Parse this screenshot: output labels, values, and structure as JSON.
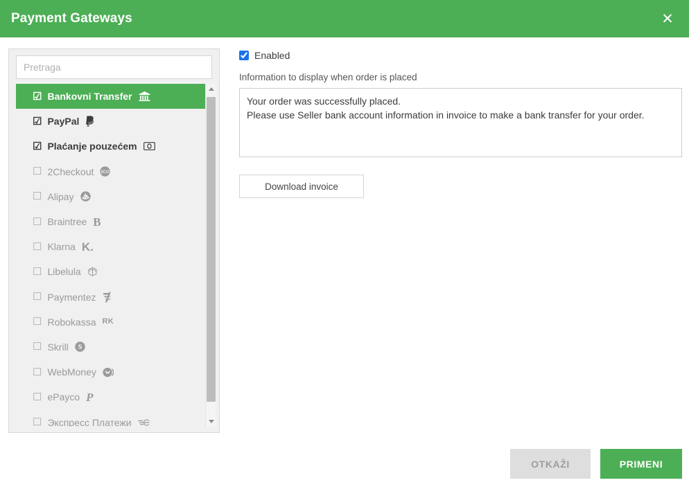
{
  "window": {
    "title": "Payment Gateways",
    "close_icon": "close-icon",
    "close_glyph": "✕",
    "header_color": "#4caf55"
  },
  "search": {
    "placeholder": "Pretraga",
    "value": ""
  },
  "gateways": [
    {
      "name": "Bankovni Transfer",
      "checked": true,
      "selected": true,
      "checkbox_glyph": "☑",
      "logo": "bank-icon"
    },
    {
      "name": "PayPal",
      "checked": true,
      "selected": false,
      "checkbox_glyph": "☑",
      "logo": "paypal-logo"
    },
    {
      "name": "Plaćanje pouzećem",
      "checked": true,
      "selected": false,
      "checkbox_glyph": "☑",
      "logo": "banknote-icon"
    },
    {
      "name": "2Checkout",
      "checked": false,
      "selected": false,
      "checkbox_glyph": "☐",
      "logo": "2checkout-logo"
    },
    {
      "name": "Alipay",
      "checked": false,
      "selected": false,
      "checkbox_glyph": "☐",
      "logo": "alipay-logo"
    },
    {
      "name": "Braintree",
      "checked": false,
      "selected": false,
      "checkbox_glyph": "☐",
      "logo": "braintree-logo"
    },
    {
      "name": "Klarna",
      "checked": false,
      "selected": false,
      "checkbox_glyph": "☐",
      "logo": "klarna-logo"
    },
    {
      "name": "Libelula",
      "checked": false,
      "selected": false,
      "checkbox_glyph": "☐",
      "logo": "libelula-logo"
    },
    {
      "name": "Paymentez",
      "checked": false,
      "selected": false,
      "checkbox_glyph": "☐",
      "logo": "paymentez-logo"
    },
    {
      "name": "Robokassa",
      "checked": false,
      "selected": false,
      "checkbox_glyph": "☐",
      "logo": "robokassa-logo"
    },
    {
      "name": "Skrill",
      "checked": false,
      "selected": false,
      "checkbox_glyph": "☐",
      "logo": "skrill-logo"
    },
    {
      "name": "WebMoney",
      "checked": false,
      "selected": false,
      "checkbox_glyph": "☐",
      "logo": "webmoney-logo"
    },
    {
      "name": "ePayco",
      "checked": false,
      "selected": false,
      "checkbox_glyph": "☐",
      "logo": "epayco-logo"
    },
    {
      "name": "Экспресс Платежи",
      "checked": false,
      "selected": false,
      "checkbox_glyph": "☐",
      "logo": "express-payments-logo"
    }
  ],
  "scrollbar": {
    "up_icon": "triangle-up-icon",
    "down_icon": "triangle-down-icon"
  },
  "details": {
    "enabled_label": "Enabled",
    "enabled_checked": true,
    "info_label": "Information to display when order is placed",
    "info_value": "Your order was successfully placed.\nPlease use Seller bank account information in invoice to make a bank transfer for your order.",
    "download_invoice_label": "Download invoice"
  },
  "footer": {
    "cancel_label": "OTKAŽI",
    "apply_label": "PRIMENI",
    "apply_color": "#4caf55",
    "cancel_color": "#dedede"
  }
}
